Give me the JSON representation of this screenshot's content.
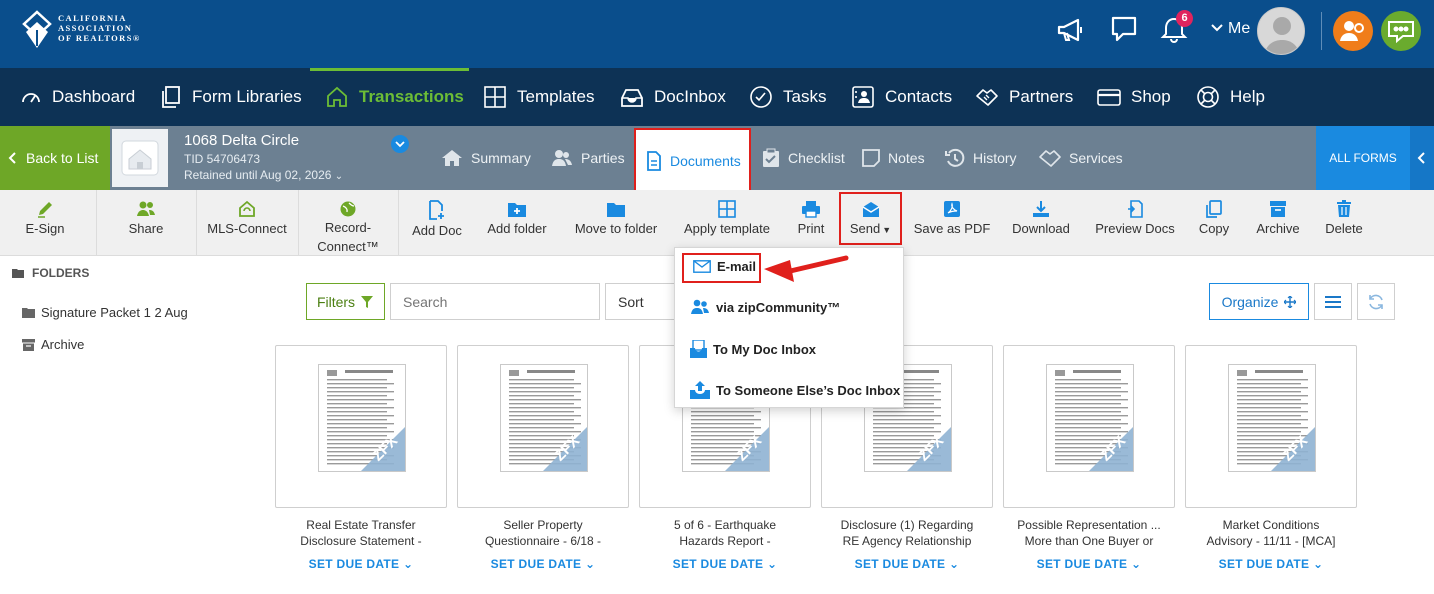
{
  "brand": {
    "logo_lines": [
      "CALIFORNIA",
      "ASSOCIATION",
      "OF REALTORS®"
    ],
    "notification_count": "6",
    "me_label": "Me"
  },
  "nav": {
    "items": [
      {
        "label": "Dashboard",
        "icon": "gauge-icon"
      },
      {
        "label": "Form Libraries",
        "icon": "copy-icon"
      },
      {
        "label": "Transactions",
        "icon": "home-icon",
        "active": true
      },
      {
        "label": "Templates",
        "icon": "grid-icon"
      },
      {
        "label": "DocInbox",
        "icon": "inbox-icon"
      },
      {
        "label": "Tasks",
        "icon": "check-circle-icon"
      },
      {
        "label": "Contacts",
        "icon": "contacts-icon"
      },
      {
        "label": "Partners",
        "icon": "handshake-icon"
      },
      {
        "label": "Shop",
        "icon": "card-icon"
      },
      {
        "label": "Help",
        "icon": "lifebuoy-icon"
      }
    ],
    "accent": "#6cbd36"
  },
  "transaction": {
    "back_label": "Back to List",
    "address": "1068 Delta Circle",
    "tid": "TID 54706473",
    "retained": "Retained until Aug 02, 2026",
    "tabs": [
      "Summary",
      "Parties",
      "Documents",
      "Checklist",
      "Notes",
      "History",
      "Services"
    ],
    "active_tab": "Documents",
    "all_forms": "ALL FORMS"
  },
  "toolbar": {
    "esign": "E-Sign",
    "share": "Share",
    "mls": "MLS-Connect",
    "record_1": "Record-",
    "record_2": "Connect™",
    "add_doc": "Add Doc",
    "add_folder": "Add folder",
    "move": "Move to folder",
    "apply_template": "Apply template",
    "print": "Print",
    "send": "Send",
    "save_pdf": "Save as PDF",
    "download": "Download",
    "preview": "Preview Docs",
    "copy": "Copy",
    "archive": "Archive",
    "delete": "Delete"
  },
  "send_menu": {
    "email": "E-mail",
    "zip": "via zipCommunity™",
    "my_inbox": "To My Doc Inbox",
    "else_inbox": "To Someone Else’s Doc Inbox"
  },
  "folders": {
    "title": "FOLDERS",
    "items": [
      "Signature Packet 1 2 Aug",
      "Archive"
    ]
  },
  "filters": {
    "filters_label": "Filters",
    "search_placeholder": "Search",
    "sort_label": "Sort",
    "organize_label": "Organize"
  },
  "documents": [
    {
      "line1": "Real Estate Transfer",
      "line2": "Disclosure Statement -",
      "due": "SET DUE DATE"
    },
    {
      "line1": "Seller Property",
      "line2": "Questionnaire - 6/18 -",
      "due": "SET DUE DATE"
    },
    {
      "line1": "5 of 6 - Earthquake",
      "line2": "Hazards Report -",
      "due": "SET DUE DATE"
    },
    {
      "line1": "Disclosure (1) Regarding",
      "line2": "RE Agency Relationship",
      "due": "SET DUE DATE"
    },
    {
      "line1": "Possible Representation ...",
      "line2": "More than One Buyer or",
      "due": "SET DUE DATE"
    },
    {
      "line1": "Market Conditions",
      "line2": "Advisory - 11/11 - [MCA]",
      "due": "SET DUE DATE"
    }
  ],
  "thumb_badge": "ZFX",
  "colors": {
    "header": "#0a4e8c",
    "nav": "#0d3255",
    "green": "#6ea727",
    "blue": "#1a8ae0",
    "highlight_red": "#e0201c"
  }
}
